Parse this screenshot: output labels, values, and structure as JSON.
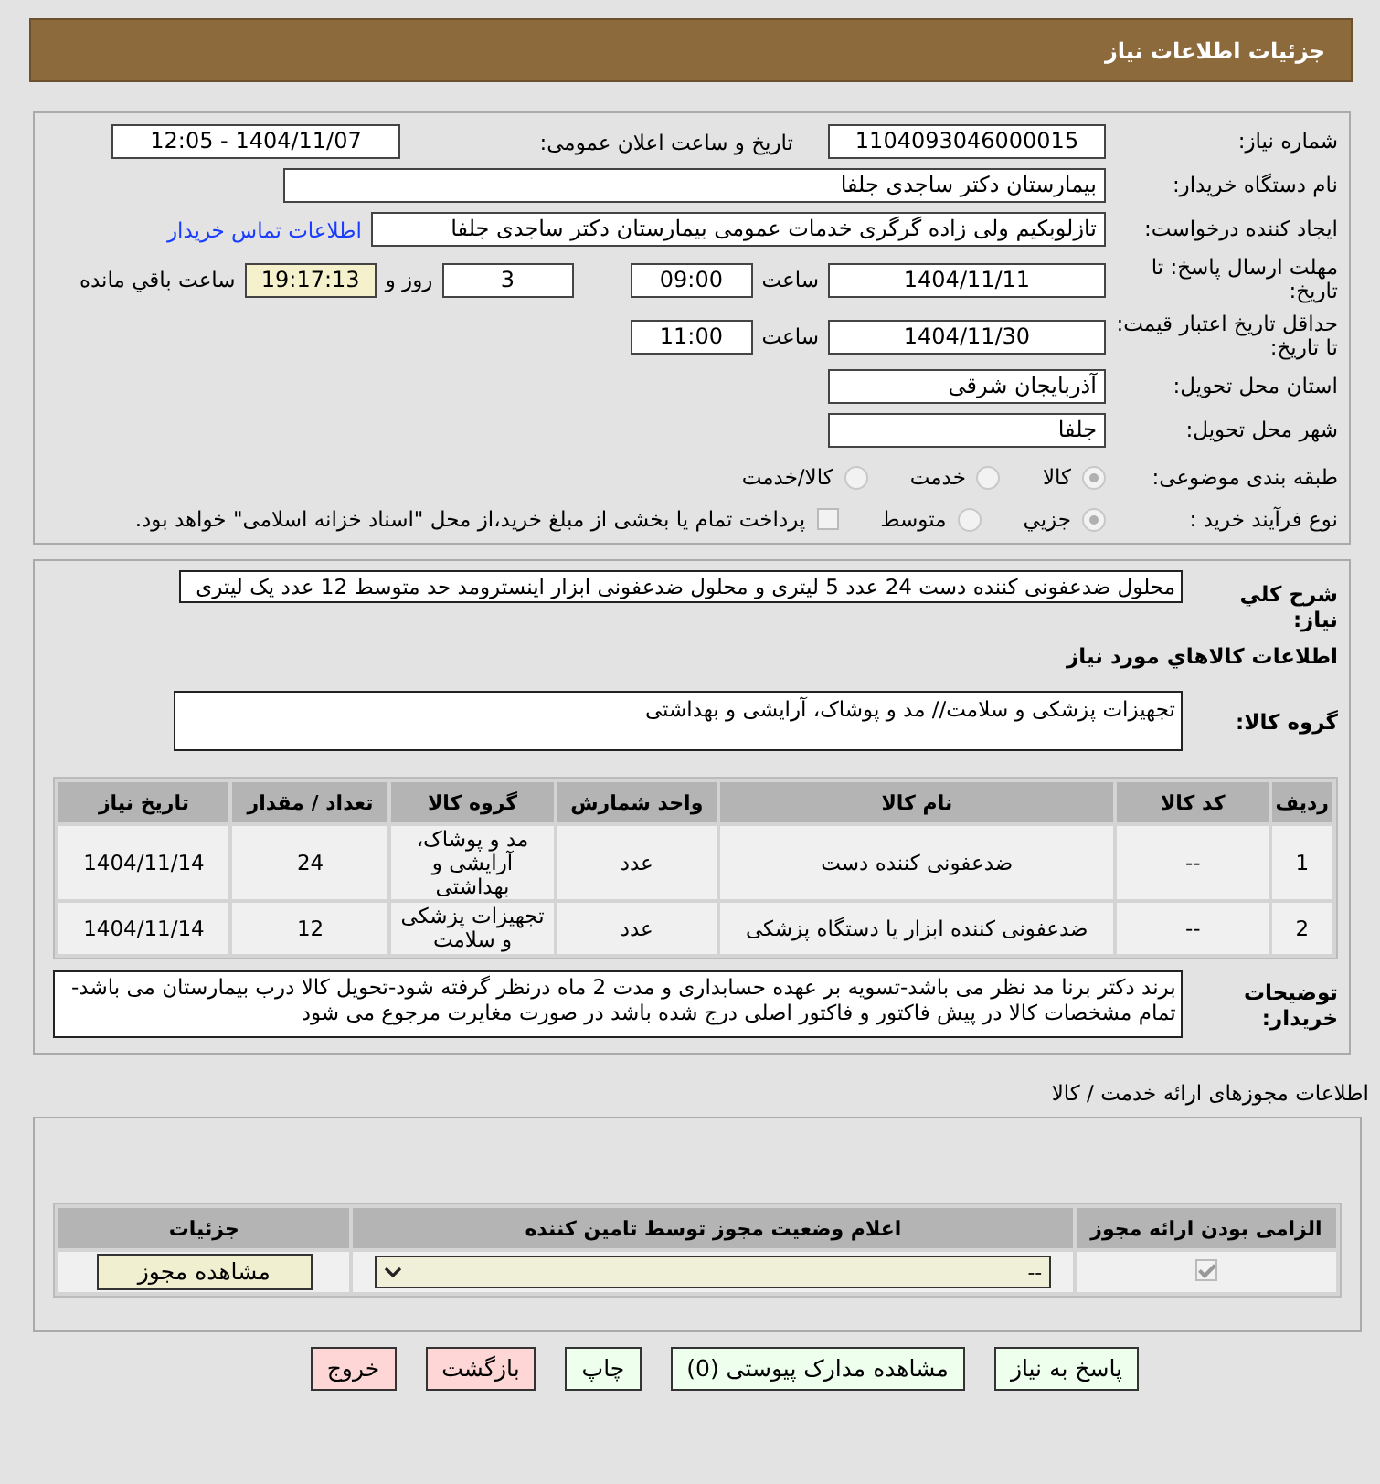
{
  "header": {
    "title": "جزئیات اطلاعات نیاز"
  },
  "details": {
    "need_number": {
      "label": "شماره نیاز:",
      "value": "1104093046000015"
    },
    "announce": {
      "label": "تاریخ و ساعت اعلان عمومی:",
      "value": "1404/11/07 - 12:05"
    },
    "buyer": {
      "label": "نام دستگاه خریدار:",
      "value": "بیمارستان دکتر ساجدی جلفا"
    },
    "requester": {
      "label": "ایجاد کننده درخواست:",
      "value": "تازلوبکیم ولی زاده گرگری خدمات عمومی بیمارستان دکتر ساجدی جلفا",
      "link": "اطلاعات تماس خریدار"
    },
    "deadline": {
      "label": "مهلت ارسال پاسخ: تا تاریخ:",
      "date": "1404/11/11",
      "time_label": "ساعت",
      "time": "09:00",
      "days": "3",
      "days_label": "روز و",
      "remaining": "19:17:13",
      "remaining_label": "ساعت باقي مانده"
    },
    "validity": {
      "label": "حداقل تاریخ اعتبار قیمت: تا تاریخ:",
      "date": "1404/11/30",
      "time_label": "ساعت",
      "time": "11:00"
    },
    "province": {
      "label": "استان محل تحویل:",
      "value": "آذربایجان شرقی"
    },
    "city": {
      "label": "شهر محل تحویل:",
      "value": "جلفا"
    },
    "category": {
      "label": "طبقه بندی موضوعی:",
      "options": [
        {
          "label": "کالا",
          "selected": true
        },
        {
          "label": "خدمت",
          "selected": false
        },
        {
          "label": "کالا/خدمت",
          "selected": false
        }
      ]
    },
    "process": {
      "label": "نوع فرآیند خرید :",
      "options": [
        {
          "label": "جزيي",
          "selected": true
        },
        {
          "label": "متوسط",
          "selected": false
        }
      ],
      "payment": {
        "label": "پرداخت تمام یا بخشی از مبلغ خرید،از محل \"اسناد خزانه اسلامی\" خواهد بود.",
        "checked": false
      }
    }
  },
  "summary": {
    "label": "شرح کلي نیاز:",
    "value": "محلول ضدعفونی کننده دست 24 عدد 5 لیتری و محلول ضدعفونی ابزار  اینسترومد حد متوسط  12 عدد یک لیتری"
  },
  "goods_title": "اطلاعات کالاهاي مورد نیاز",
  "goods_group": {
    "label": "گروه کالا:",
    "value": "تجهیزات پزشکی و سلامت// مد و پوشاک، آرایشی و بهداشتی"
  },
  "items_table": {
    "columns": [
      "ردیف",
      "کد کالا",
      "نام کالا",
      "واحد شمارش",
      "گروه کالا",
      "تعداد / مقدار",
      "تاریخ نیاز"
    ],
    "rows": [
      [
        "1",
        "--",
        "ضدعفونی کننده دست",
        "عدد",
        "مد و پوشاک، آرایشی و بهداشتی",
        "24",
        "1404/11/14"
      ],
      [
        "2",
        "--",
        "ضدعفونی کننده ابزار یا دستگاه پزشکی",
        "عدد",
        "تجهیزات پزشکی و سلامت",
        "12",
        "1404/11/14"
      ]
    ]
  },
  "buyer_notes": {
    "label": "توضیحات خریدار:",
    "value": "برند دکتر برنا مد نظر می باشد-تسویه بر عهده حسابداری و مدت 2 ماه درنظر گرفته شود-تحویل کالا درب بیمارستان می باشد-تمام مشخصات کالا در پیش فاکتور و فاکتور اصلی درج شده باشد در صورت مغایرت مرجوع می شود"
  },
  "permits": {
    "title": "اطلاعات مجوزهای ارائه خدمت / کالا",
    "columns": [
      "الزامی بودن ارائه مجوز",
      "اعلام وضعیت مجوز توسط تامین کننده",
      "جزئیات"
    ],
    "rows": [
      {
        "required": true,
        "status": "--",
        "details_button": "مشاهده مجوز"
      }
    ]
  },
  "buttons": [
    {
      "label": "پاسخ به نیاز",
      "kind": "action"
    },
    {
      "label": "مشاهده مدارک پیوستی (0)",
      "kind": "action"
    },
    {
      "label": "چاپ",
      "kind": "action"
    },
    {
      "label": "بازگشت",
      "kind": "exit"
    },
    {
      "label": "خروج",
      "kind": "exit"
    }
  ]
}
